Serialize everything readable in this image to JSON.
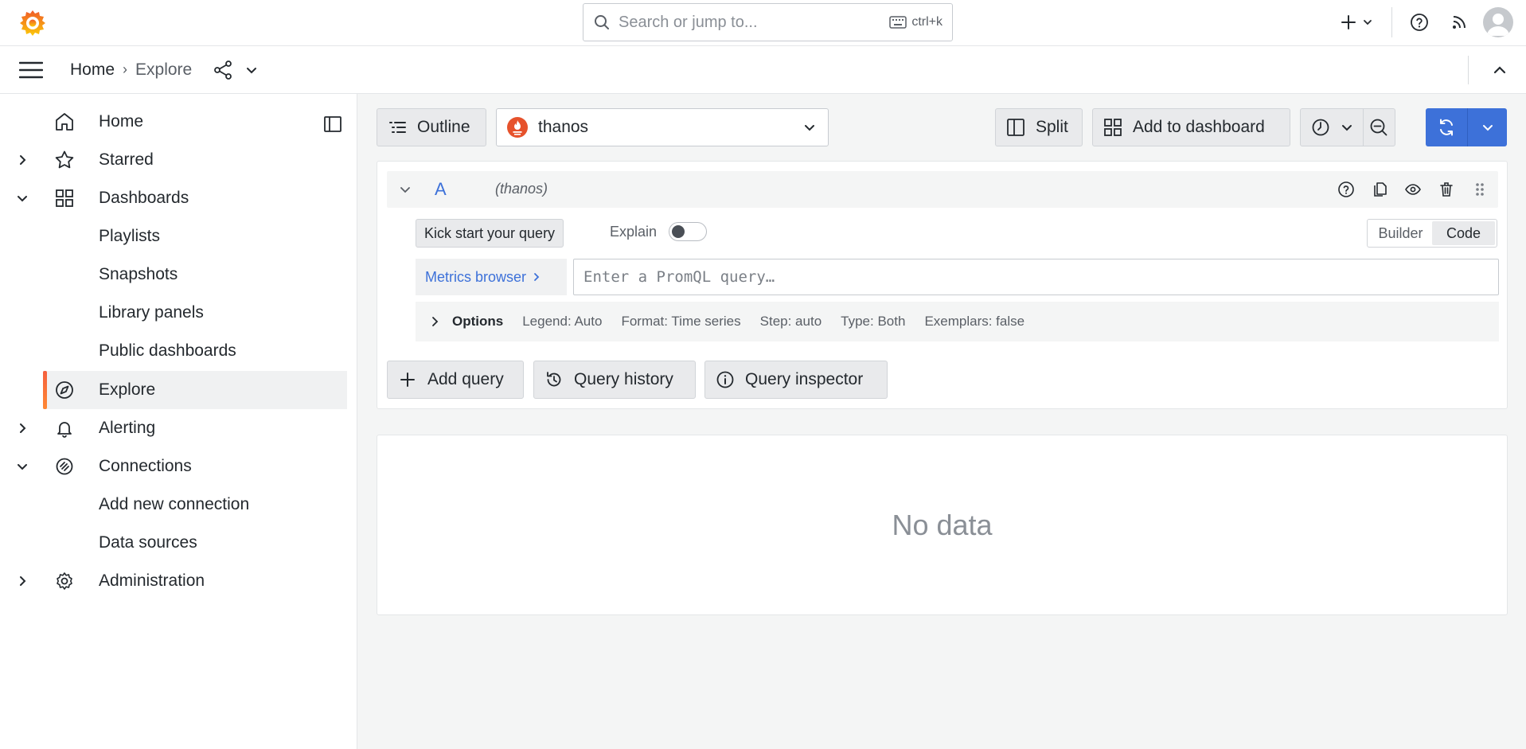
{
  "search": {
    "placeholder": "Search or jump to...",
    "shortcut": "ctrl+k"
  },
  "breadcrumb": {
    "home": "Home",
    "separator": "›",
    "current": "Explore"
  },
  "sidebar": {
    "items": [
      {
        "label": "Home",
        "icon": "home-icon"
      },
      {
        "label": "Starred",
        "icon": "star-icon"
      },
      {
        "label": "Dashboards",
        "icon": "dashboards-icon"
      },
      {
        "label": "Playlists"
      },
      {
        "label": "Snapshots"
      },
      {
        "label": "Library panels"
      },
      {
        "label": "Public dashboards"
      },
      {
        "label": "Explore",
        "icon": "compass-icon"
      },
      {
        "label": "Alerting",
        "icon": "bell-icon"
      },
      {
        "label": "Connections",
        "icon": "connections-icon"
      },
      {
        "label": "Add new connection"
      },
      {
        "label": "Data sources"
      },
      {
        "label": "Administration",
        "icon": "gear-icon"
      }
    ]
  },
  "toolbar": {
    "outline": "Outline",
    "datasource": "thanos",
    "split": "Split",
    "add_to_dashboard": "Add to dashboard"
  },
  "query": {
    "ref": "A",
    "datasource_label": "(thanos)",
    "kick_start": "Kick start your query",
    "explain": "Explain",
    "builder": "Builder",
    "code": "Code",
    "metrics_browser": "Metrics browser",
    "promql_placeholder": "Enter a PromQL query…",
    "options": {
      "label": "Options",
      "legend": "Legend: Auto",
      "format": "Format: Time series",
      "step": "Step: auto",
      "type": "Type: Both",
      "exemplars": "Exemplars: false"
    }
  },
  "actions": {
    "add_query": "Add query",
    "query_history": "Query history",
    "query_inspector": "Query inspector"
  },
  "result": {
    "no_data": "No data"
  },
  "colors": {
    "accent": "#3d71d9",
    "brand": "#f46800"
  }
}
